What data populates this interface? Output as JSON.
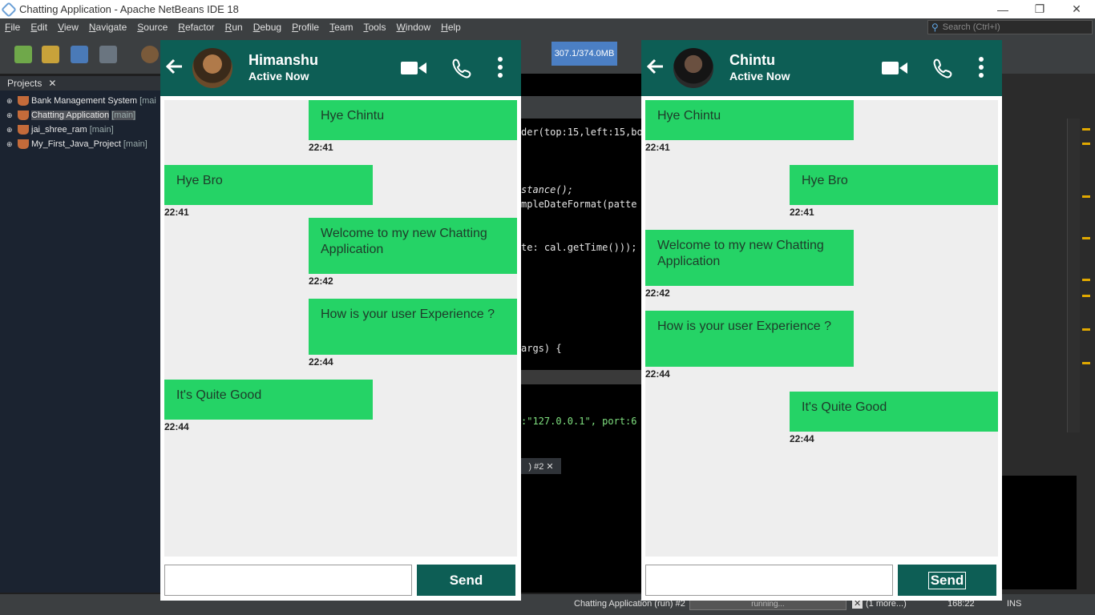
{
  "window": {
    "title": "Chatting Application - Apache NetBeans IDE 18",
    "min": "—",
    "restore": "❐",
    "close": "✕"
  },
  "menu": [
    "File",
    "Edit",
    "View",
    "Navigate",
    "Source",
    "Refactor",
    "Run",
    "Debug",
    "Profile",
    "Team",
    "Tools",
    "Window",
    "Help"
  ],
  "search_placeholder": "Search (Ctrl+I)",
  "memory": "307.1/374.0MB",
  "projects": {
    "tab": "Projects",
    "close": "✕",
    "items": [
      {
        "name": "Bank Management System",
        "suffix": "[mai"
      },
      {
        "name": "Chatting Application",
        "suffix": "[main]"
      },
      {
        "name": "jai_shree_ram",
        "suffix": "[main]"
      },
      {
        "name": "My_First_Java_Project",
        "suffix": "[main]"
      }
    ]
  },
  "code_lines": [
    "der(top:15,left:15,bo",
    "stance();",
    "mpleDateFormat(patte",
    "te: cal.getTime()));",
    "args) {",
    ":\"127.0.0.1\", port:6"
  ],
  "output_tab": ") #2  ✕",
  "status": {
    "task": "Chatting Application (run) #2",
    "progress": "running...",
    "more": "(1 more...)",
    "position": "168:22",
    "mode": "INS"
  },
  "chats": [
    {
      "name": "Himanshu",
      "status": "Active Now",
      "messages": [
        {
          "text": "Hye Chintu",
          "time": "22:41",
          "side": "right"
        },
        {
          "text": "Hye Bro",
          "time": "22:41",
          "side": "left"
        },
        {
          "text": "Welcome to my new Chatting Application",
          "time": "22:42",
          "side": "right"
        },
        {
          "text": "How is your user Experience ?",
          "time": "22:44",
          "side": "right"
        },
        {
          "text": "It's Quite Good",
          "time": "22:44",
          "side": "left"
        }
      ],
      "input_value": "",
      "send": "Send"
    },
    {
      "name": "Chintu",
      "status": "Active Now",
      "messages": [
        {
          "text": "Hye Chintu",
          "time": "22:41",
          "side": "left"
        },
        {
          "text": "Hye Bro",
          "time": "22:41",
          "side": "right"
        },
        {
          "text": "Welcome to my new Chatting Application",
          "time": "22:42",
          "side": "left"
        },
        {
          "text": "How is your user Experience ?",
          "time": "22:44",
          "side": "left"
        },
        {
          "text": "It's Quite Good",
          "time": "22:44",
          "side": "right"
        }
      ],
      "input_value": "",
      "send": "Send"
    }
  ]
}
